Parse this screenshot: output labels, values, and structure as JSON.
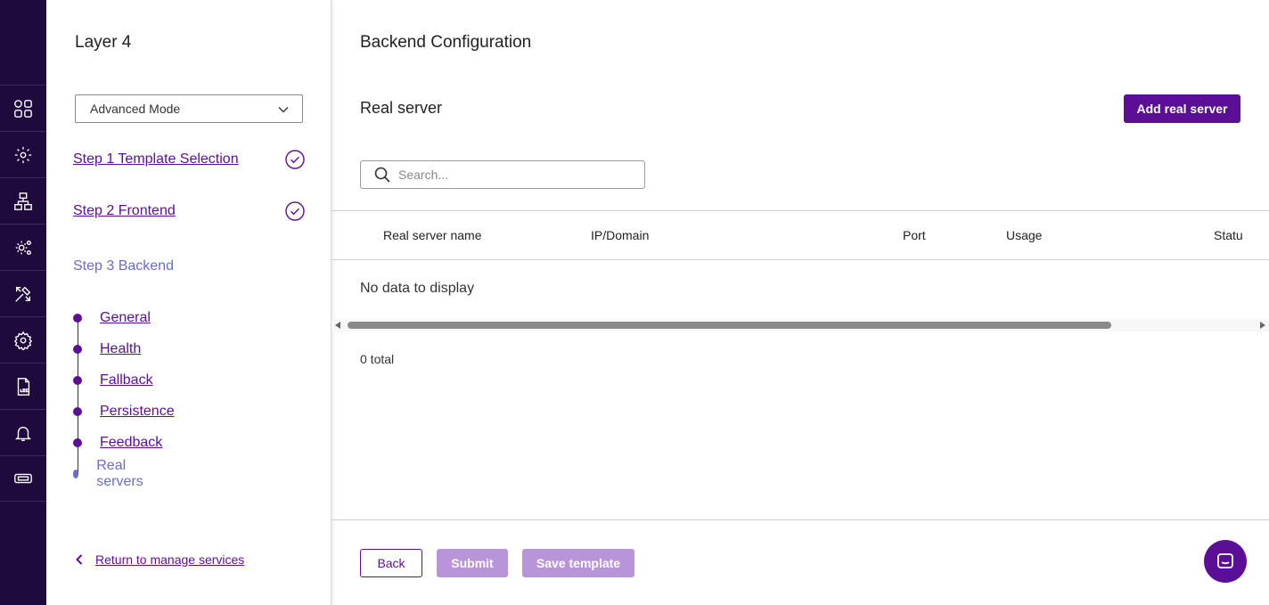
{
  "rail": {
    "icons": [
      "dashboard-icon",
      "services-gear-icon",
      "network-icon",
      "settings-cog-icon",
      "tools-icon",
      "gear-icon",
      "log-icon",
      "bell-icon",
      "ticket-icon"
    ]
  },
  "wizard": {
    "title": "Layer 4",
    "mode": {
      "selected": "Advanced Mode"
    },
    "steps": [
      {
        "label": "Step 1 Template Selection",
        "completed": true
      },
      {
        "label": "Step 2 Frontend",
        "completed": true
      },
      {
        "label": "Step 3 Backend",
        "current": true
      }
    ],
    "substeps": [
      {
        "label": "General"
      },
      {
        "label": "Health"
      },
      {
        "label": "Fallback"
      },
      {
        "label": "Persistence"
      },
      {
        "label": "Feedback"
      },
      {
        "label": "Real servers",
        "current": true
      }
    ],
    "return_label": "Return to manage services"
  },
  "main": {
    "title": "Backend Configuration",
    "section_title": "Real server",
    "add_button": "Add real server",
    "search": {
      "placeholder": "Search...",
      "value": ""
    },
    "table": {
      "columns": [
        "Real server name",
        "IP/Domain",
        "Port",
        "Usage",
        "Statu"
      ],
      "rows": [],
      "empty_message": "No data to display",
      "total": "0 total"
    },
    "footer": {
      "back": "Back",
      "submit": "Submit",
      "save_template": "Save template"
    }
  },
  "colors": {
    "rail_bg": "#1e0a3c",
    "accent": "#5a0f96",
    "accent_disabled": "#b795d8",
    "current_step": "#6a6ec4"
  }
}
